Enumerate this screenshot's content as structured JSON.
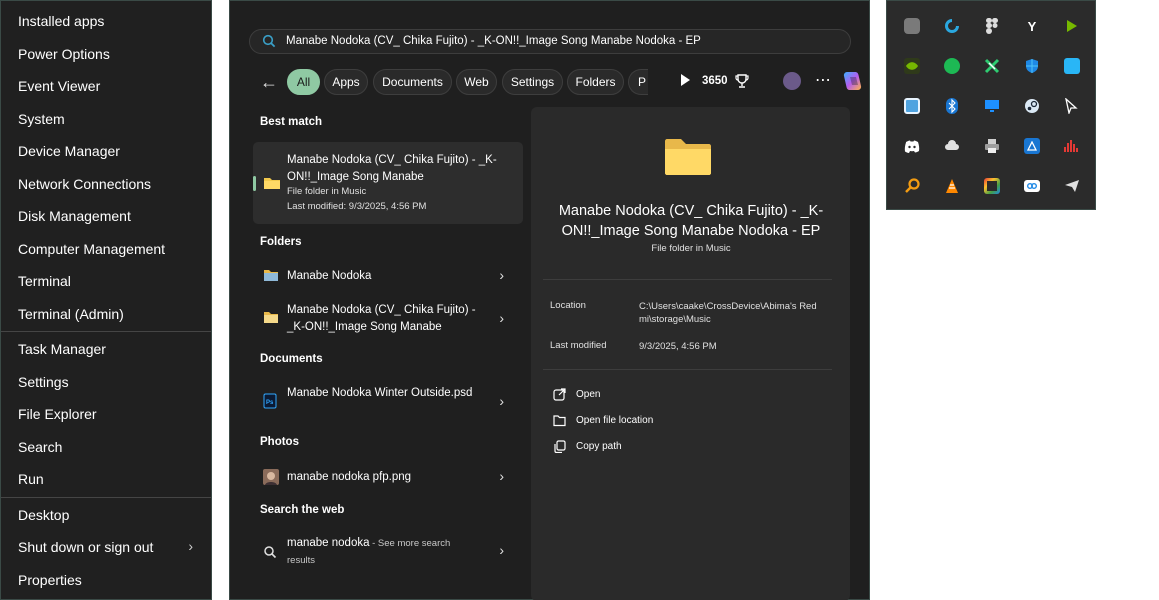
{
  "winx_menu": {
    "items_group1": [
      "Installed apps",
      "Power Options",
      "Event Viewer",
      "System",
      "Device Manager",
      "Network Connections",
      "Disk Management",
      "Computer Management",
      "Terminal",
      "Terminal (Admin)"
    ],
    "items_group2": [
      "Task Manager",
      "Settings",
      "File Explorer",
      "Search",
      "Run"
    ],
    "items_group3": [
      "Desktop",
      "Shut down or sign out",
      "Properties"
    ]
  },
  "search": {
    "query": "Manabe Nodoka (CV_ Chika Fujito) - _K-ON!!_Image Song Manabe Nodoka - EP",
    "filters": [
      "All",
      "Apps",
      "Documents",
      "Web",
      "Settings",
      "Folders",
      "P"
    ],
    "active_filter": "All",
    "points": "3650",
    "sections": {
      "best_match": "Best match",
      "folders": "Folders",
      "documents": "Documents",
      "photos": "Photos",
      "web": "Search the web"
    },
    "best_match": {
      "title": "Manabe Nodoka (CV_ Chika Fujito) - _K-ON!!_Image Song Manabe",
      "type": "File folder in Music",
      "modified": "Last modified: 9/3/2025, 4:56 PM"
    },
    "folders": [
      {
        "title": "Manabe Nodoka"
      },
      {
        "title": "Manabe Nodoka (CV_ Chika Fujito) - _K-ON!!_Image Song Manabe"
      }
    ],
    "documents": [
      {
        "title": "Manabe Nodoka Winter Outside.psd"
      }
    ],
    "photos": [
      {
        "title": "manabe nodoka pfp.png"
      }
    ],
    "web": {
      "query": "manabe nodoka",
      "suffix": " - See more search results"
    },
    "details": {
      "title": "Manabe Nodoka (CV_ Chika Fujito) - _K-ON!!_Image Song Manabe Nodoka - EP",
      "subtitle": "File folder in Music",
      "location_label": "Location",
      "location_value": "C:\\Users\\caake\\CrossDevice\\Abima's Redmi\\storage\\Music",
      "modified_label": "Last modified",
      "modified_value": "9/3/2025, 4:56 PM",
      "actions": [
        "Open",
        "Open file location",
        "Copy path"
      ]
    }
  },
  "tray": {
    "icons": [
      "chip-icon",
      "vpn-icon",
      "figma-icon",
      "yandex-icon",
      "nvidia-play-icon",
      "nvidia-icon",
      "spotify-icon",
      "xbox-icon",
      "defender-icon",
      "square-app-icon",
      "window-app-icon",
      "bluetooth-icon",
      "display-icon",
      "steam-icon",
      "cursor-icon",
      "discord-icon",
      "cloud-icon",
      "printer-icon",
      "store-icon",
      "audio-icon",
      "search-app-icon",
      "vlc-icon",
      "photo-app-icon",
      "link-icon",
      "send-icon"
    ]
  }
}
